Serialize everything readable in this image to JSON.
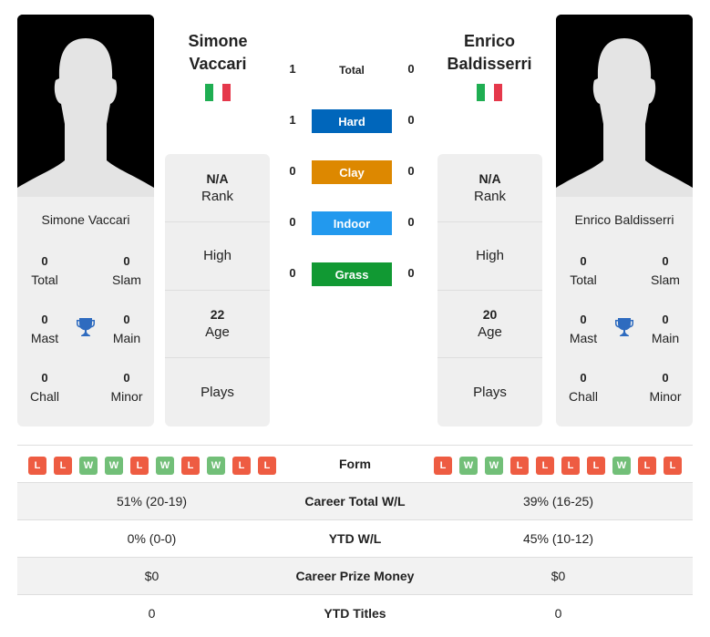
{
  "colors": {
    "hard": "#0066bb",
    "clay": "#dd8800",
    "indoor": "#2299ee",
    "grass": "#119933",
    "win": "#72bf78",
    "loss": "#ee5c42",
    "flag_green": "#1fae52",
    "flag_white": "#ffffff",
    "flag_red": "#e5384b",
    "trophy": "#2e6bbf"
  },
  "player1": {
    "first_name": "Simone",
    "last_name": "Vaccari",
    "full_name": "Simone Vaccari",
    "country_flag": "italy-flag",
    "titles": {
      "total": {
        "value": "0",
        "label": "Total"
      },
      "slam": {
        "value": "0",
        "label": "Slam"
      },
      "mast": {
        "value": "0",
        "label": "Mast"
      },
      "main": {
        "value": "0",
        "label": "Main"
      },
      "chall": {
        "value": "0",
        "label": "Chall"
      },
      "minor": {
        "value": "0",
        "label": "Minor"
      }
    },
    "info": {
      "rank_value": "N/A",
      "rank_label": "Rank",
      "high_label": "High",
      "age_value": "22",
      "age_label": "Age",
      "plays_label": "Plays"
    },
    "form": [
      "L",
      "L",
      "W",
      "W",
      "L",
      "W",
      "L",
      "W",
      "L",
      "L"
    ],
    "career_total_wl": "51% (20-19)",
    "ytd_wl": "0% (0-0)",
    "career_prize_money": "$0",
    "ytd_titles": "0"
  },
  "player2": {
    "first_name": "Enrico",
    "last_name": "Baldisserri",
    "full_name": "Enrico Baldisserri",
    "country_flag": "italy-flag",
    "titles": {
      "total": {
        "value": "0",
        "label": "Total"
      },
      "slam": {
        "value": "0",
        "label": "Slam"
      },
      "mast": {
        "value": "0",
        "label": "Mast"
      },
      "main": {
        "value": "0",
        "label": "Main"
      },
      "chall": {
        "value": "0",
        "label": "Chall"
      },
      "minor": {
        "value": "0",
        "label": "Minor"
      }
    },
    "info": {
      "rank_value": "N/A",
      "rank_label": "Rank",
      "high_label": "High",
      "age_value": "20",
      "age_label": "Age",
      "plays_label": "Plays"
    },
    "form": [
      "L",
      "W",
      "W",
      "L",
      "L",
      "L",
      "L",
      "W",
      "L",
      "L"
    ],
    "career_total_wl": "39% (16-25)",
    "ytd_wl": "45% (10-12)",
    "career_prize_money": "$0",
    "ytd_titles": "0"
  },
  "h2h": [
    {
      "label": "Total",
      "p1": "1",
      "p2": "0",
      "style": "plain"
    },
    {
      "label": "Hard",
      "p1": "1",
      "p2": "0",
      "style": "hard"
    },
    {
      "label": "Clay",
      "p1": "0",
      "p2": "0",
      "style": "clay"
    },
    {
      "label": "Indoor",
      "p1": "0",
      "p2": "0",
      "style": "indoor"
    },
    {
      "label": "Grass",
      "p1": "0",
      "p2": "0",
      "style": "grass"
    }
  ],
  "comparison": {
    "form_label": "Form",
    "career_total_wl_label": "Career Total W/L",
    "ytd_wl_label": "YTD W/L",
    "career_prize_money_label": "Career Prize Money",
    "ytd_titles_label": "YTD Titles"
  }
}
